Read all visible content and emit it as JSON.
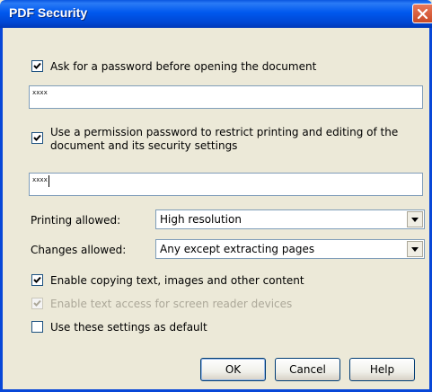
{
  "window": {
    "title": "PDF Security"
  },
  "password_open": {
    "checkbox_label": "Ask for a password before opening the document",
    "checked": true,
    "field_value": "xxxx"
  },
  "permission": {
    "checkbox_label_line1": "Use a permission password to restrict printing and editing of the",
    "checkbox_label_line2": "document and its security settings",
    "checked": true,
    "field_value": "xxxx"
  },
  "printing": {
    "label": "Printing allowed:",
    "value": "High resolution"
  },
  "changes": {
    "label": "Changes allowed:",
    "value": "Any except extracting pages"
  },
  "options": [
    {
      "label": "Enable copying text, images and other content",
      "checked": true,
      "enabled": true
    },
    {
      "label": "Enable text access for screen reader devices",
      "checked": true,
      "enabled": false
    },
    {
      "label": "Use these settings as default",
      "checked": false,
      "enabled": true
    }
  ],
  "buttons": {
    "ok": "OK",
    "cancel": "Cancel",
    "help": "Help"
  }
}
